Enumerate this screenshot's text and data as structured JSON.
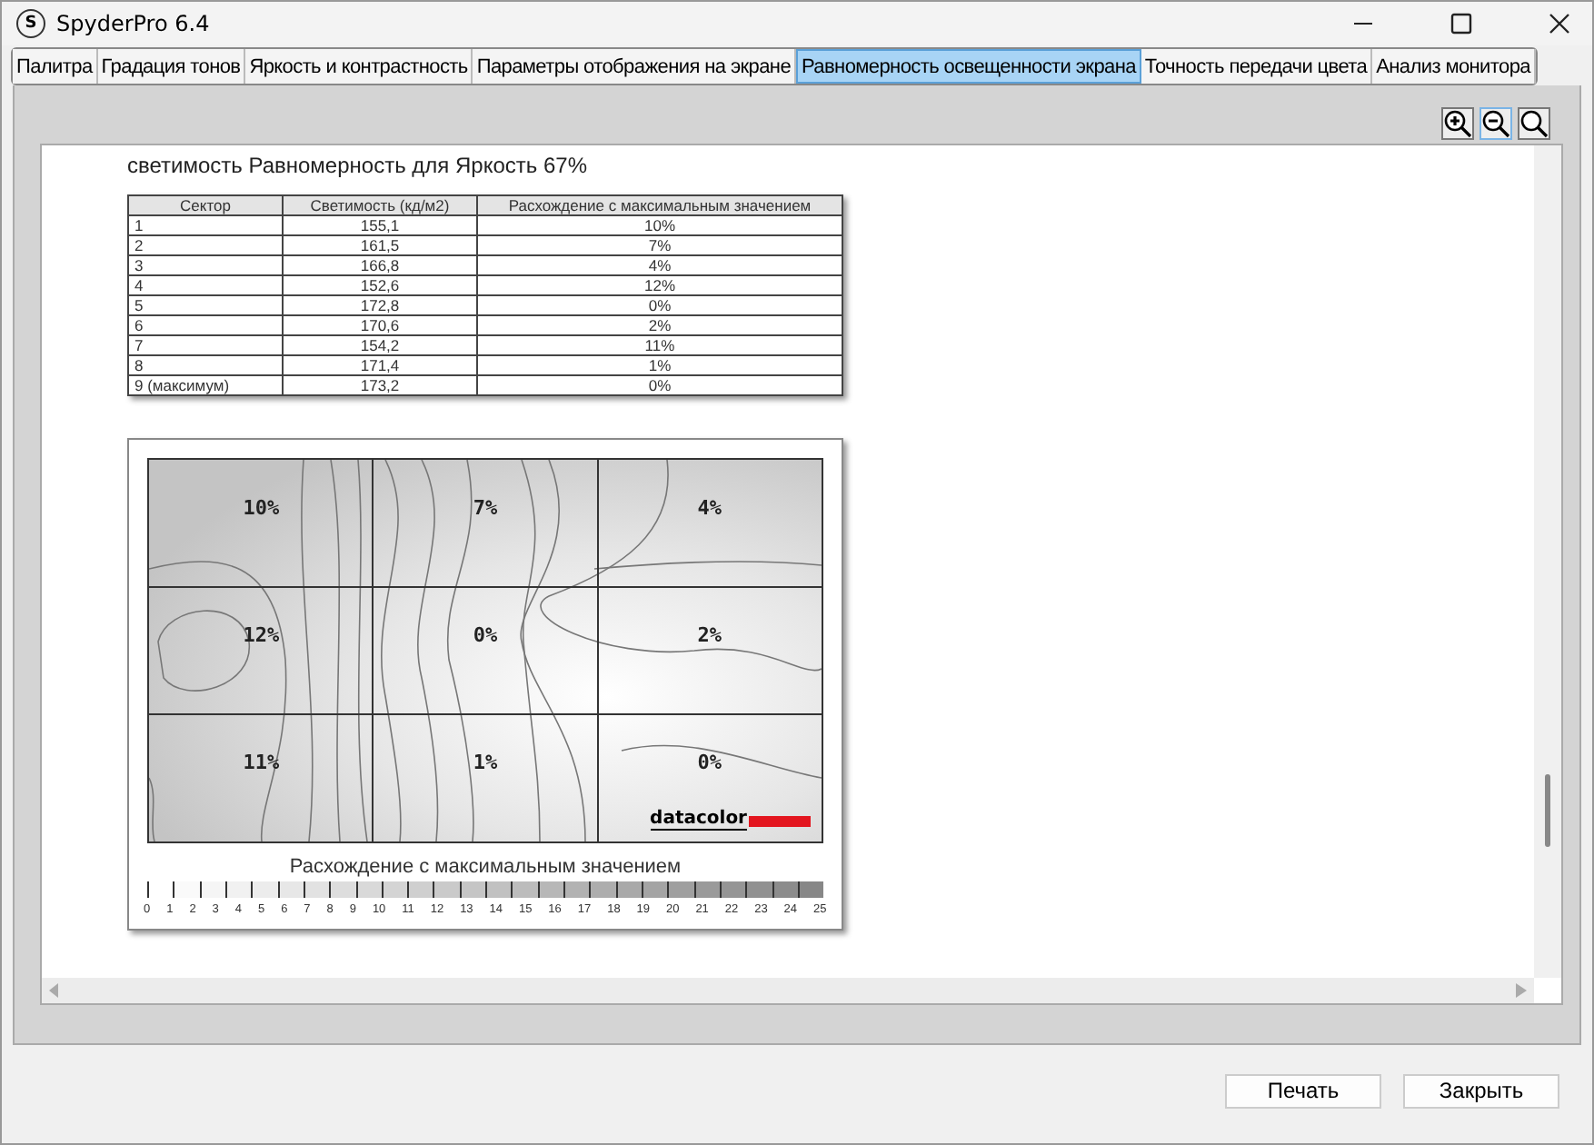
{
  "window": {
    "title": "SpyderPro 6.4",
    "app_icon": "S"
  },
  "tabs": [
    {
      "label": "Палитра",
      "selected": false
    },
    {
      "label": "Градация тонов",
      "selected": false
    },
    {
      "label": "Яркость и контрастность",
      "selected": false
    },
    {
      "label": "Параметры отображения на экране",
      "selected": false
    },
    {
      "label": "Равномерность освещенности экрана",
      "selected": true
    },
    {
      "label": "Точность передачи цвета",
      "selected": false
    },
    {
      "label": "Анализ монитора",
      "selected": false
    }
  ],
  "report": {
    "heading": "светимость Равномерность для Яркость 67%",
    "table": {
      "columns": [
        "Сектор",
        "Светимость (кд/м2)",
        "Расхождение с максимальным значением"
      ],
      "rows": [
        [
          "1",
          "155,1",
          "10%"
        ],
        [
          "2",
          "161,5",
          "7%"
        ],
        [
          "3",
          "166,8",
          "4%"
        ],
        [
          "4",
          "152,6",
          "12%"
        ],
        [
          "5",
          "172,8",
          "0%"
        ],
        [
          "6",
          "170,6",
          "2%"
        ],
        [
          "7",
          "154,2",
          "11%"
        ],
        [
          "8",
          "171,4",
          "1%"
        ],
        [
          "9 (максимум)",
          "173,2",
          "0%"
        ]
      ]
    },
    "map": {
      "cells": [
        "10%",
        "7%",
        "4%",
        "12%",
        "0%",
        "2%",
        "11%",
        "1%",
        "0%"
      ],
      "logo": "datacolor",
      "legend_title": "Расхождение с максимальным значением",
      "legend_ticks": [
        "0",
        "1",
        "2",
        "3",
        "4",
        "5",
        "6",
        "7",
        "8",
        "9",
        "10",
        "11",
        "12",
        "13",
        "14",
        "15",
        "16",
        "17",
        "18",
        "19",
        "20",
        "21",
        "22",
        "23",
        "24",
        "25"
      ]
    }
  },
  "buttons": [
    "Печать",
    "Закрыть"
  ]
}
